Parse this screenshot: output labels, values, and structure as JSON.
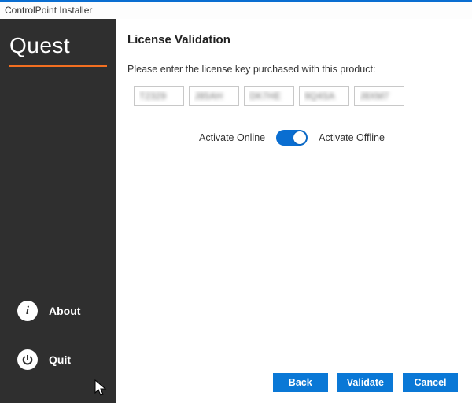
{
  "window": {
    "title": "ControlPoint Installer"
  },
  "brand": {
    "name": "Quest"
  },
  "sidebar": {
    "about_label": "About",
    "quit_label": "Quit"
  },
  "page": {
    "title": "License Validation",
    "instruction": "Please enter the license key purchased with this product:"
  },
  "license_key": {
    "seg1": "T2329",
    "seg2": "J85AH",
    "seg3": "DK7HE",
    "seg4": "9Q4SA",
    "seg5": "J8XM7"
  },
  "toggle": {
    "left_label": "Activate Online",
    "right_label": "Activate Offline",
    "state": "online"
  },
  "buttons": {
    "back": "Back",
    "validate": "Validate",
    "cancel": "Cancel"
  }
}
